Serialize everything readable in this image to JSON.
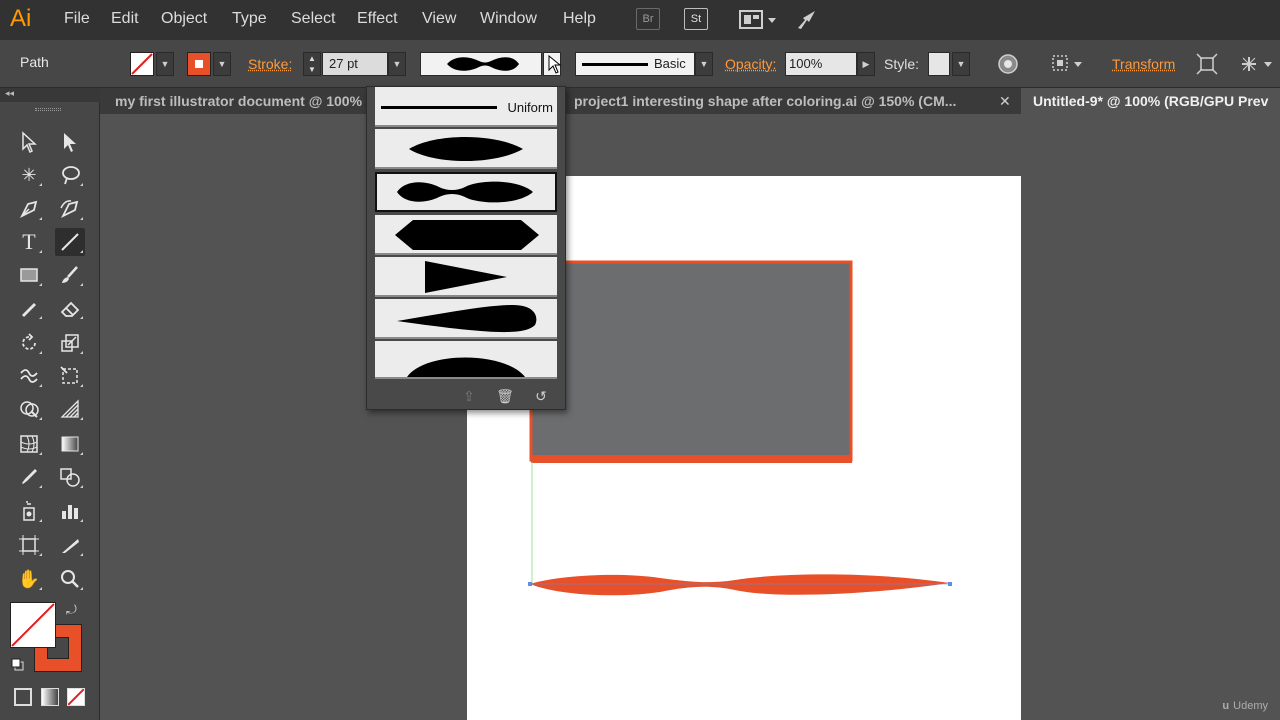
{
  "app": {
    "logo": "Ai"
  },
  "menu": [
    "File",
    "Edit",
    "Object",
    "Type",
    "Select",
    "Effect",
    "View",
    "Window",
    "Help"
  ],
  "menubar_icons": {
    "bridge": "Br",
    "stock": "St"
  },
  "control": {
    "selection_type": "Path",
    "stroke_label": "Stroke:",
    "stroke_weight": "27 pt",
    "brush_label": "Basic",
    "opacity_label": "Opacity:",
    "opacity_value": "100%",
    "style_label": "Style:",
    "transform_label": "Transform"
  },
  "tabs": [
    {
      "label": "my first illustrator document @ 100%"
    },
    {
      "label": "project1 interesting shape after coloring.ai @ 150% (CM..."
    },
    {
      "label": "Untitled-9* @ 100% (RGB/GPU Prev"
    }
  ],
  "profile_dropdown": {
    "items": [
      "Uniform",
      "",
      "",
      "",
      "",
      "",
      ""
    ],
    "selected_index": 2
  },
  "colors": {
    "accent": "#ff9a00",
    "stroke": "#e8502a",
    "fill_rect": "#6b6d6e",
    "artboard": "#ffffff",
    "workspace": "#535353"
  },
  "watermark": "Udemy"
}
